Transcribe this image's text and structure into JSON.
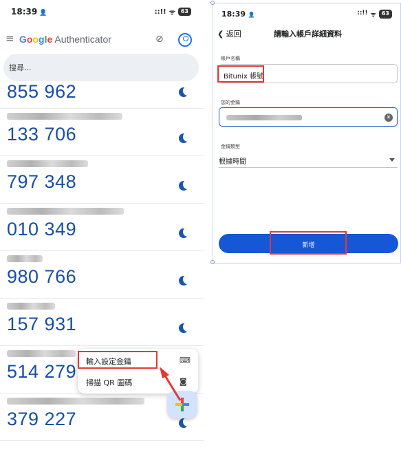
{
  "left_phone": {
    "status": {
      "time": "18:39",
      "signal": "::!!",
      "wifi": "ᯤ",
      "battery": "63"
    },
    "app": {
      "brand_google": "Google",
      "brand_auth": "Authenticator"
    },
    "search": {
      "placeholder": "搜尋..."
    },
    "codes": [
      "855 962",
      "133 706",
      "797 348",
      "010 349",
      "980 766",
      "157 931",
      "514 279",
      "379 227"
    ],
    "menu": {
      "enter_key": "輸入設定金鑰",
      "scan_qr": "掃描 QR 圖碼"
    }
  },
  "right_phone": {
    "status": {
      "time": "18:39",
      "signal": "::!!",
      "wifi": "ᯤ",
      "battery": "63"
    },
    "nav": {
      "back": "返回",
      "title": "請輸入帳戶詳細資料"
    },
    "fields": {
      "account_label": "帳戶名稱",
      "account_value": "Bitunix 帳號",
      "key_label": "您的金鑰",
      "type_label": "金鑰類型",
      "type_value": "根據時間"
    },
    "add_button": "新增"
  },
  "colors": {
    "code_blue": "#174ea6",
    "highlight_red": "#e53935",
    "button_blue": "#1557d6"
  }
}
